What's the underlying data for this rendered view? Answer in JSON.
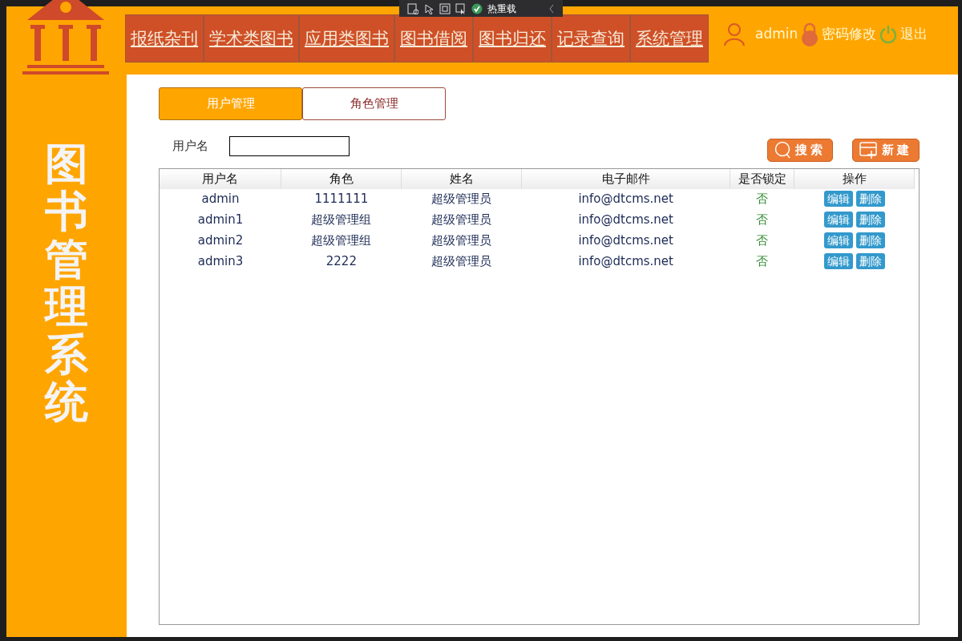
{
  "debug_toolbar": {
    "label": "热重载"
  },
  "sidebar": {
    "title": "图书管理系统"
  },
  "nav": [
    {
      "label": "报纸杂刊"
    },
    {
      "label": "学术类图书"
    },
    {
      "label": "应用类图书"
    },
    {
      "label": "图书借阅"
    },
    {
      "label": "图书归还"
    },
    {
      "label": "记录查询"
    },
    {
      "label": "系统管理"
    }
  ],
  "user": {
    "name": "admin",
    "change_password": "密码修改",
    "logout": "退出"
  },
  "tabs": [
    {
      "label": "用户管理",
      "selected": true
    },
    {
      "label": "角色管理",
      "selected": false
    }
  ],
  "filter": {
    "label": "用户名"
  },
  "buttons": {
    "search": "搜索",
    "create": "新建"
  },
  "table": {
    "columns": [
      "用户名",
      "角色",
      "姓名",
      "电子邮件",
      "是否锁定",
      "操作"
    ],
    "rows": [
      {
        "username": "admin",
        "role": "1111111",
        "name": "超级管理员",
        "email": "info@dtcms.net",
        "locked": "否",
        "actions": [
          "编辑",
          "删除"
        ]
      },
      {
        "username": "admin1",
        "role": "超级管理组",
        "name": "超级管理员",
        "email": "info@dtcms.net",
        "locked": "否",
        "actions": [
          "编辑",
          "删除"
        ]
      },
      {
        "username": "admin2",
        "role": "超级管理组",
        "name": "超级管理员",
        "email": "info@dtcms.net",
        "locked": "否",
        "actions": [
          "编辑",
          "删除"
        ]
      },
      {
        "username": "admin3",
        "role": "2222",
        "name": "超级管理员",
        "email": "info@dtcms.net",
        "locked": "否",
        "actions": [
          "编辑",
          "删除"
        ]
      }
    ]
  }
}
